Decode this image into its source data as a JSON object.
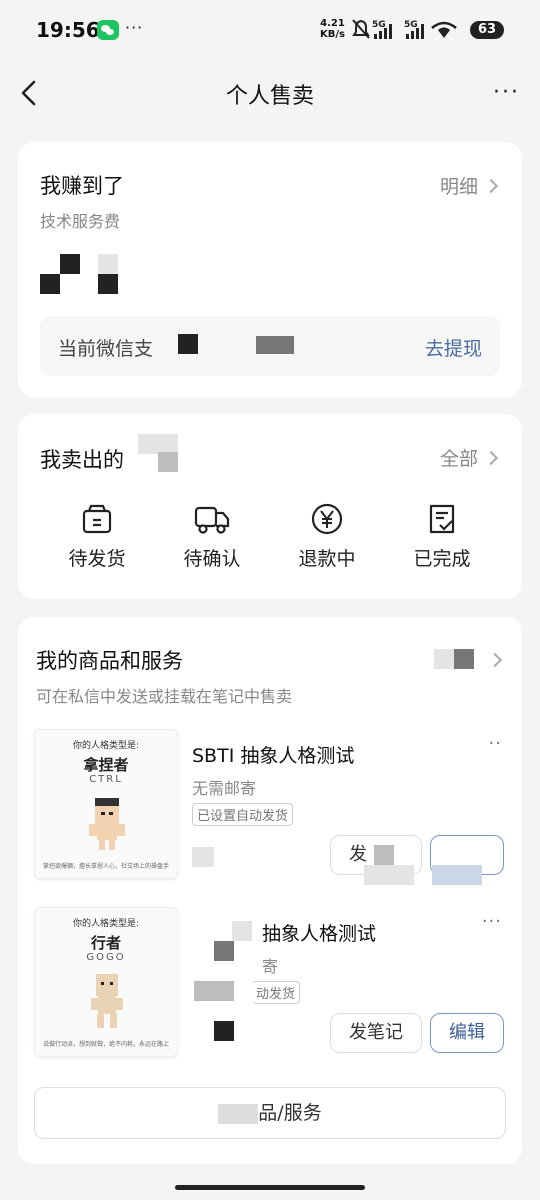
{
  "status_bar": {
    "time": "19:56",
    "dots": "···",
    "net_speed_value": "4.21",
    "net_speed_unit": "KB/s",
    "battery": "63",
    "signal_labels": [
      "5G",
      "5G"
    ]
  },
  "nav": {
    "title": "个人售卖",
    "more": "···"
  },
  "earnings": {
    "title": "我赚到了",
    "subtitle": "技术服务费",
    "details_link": "明细",
    "wechat_label": "当前微信支",
    "withdraw": "去提现"
  },
  "sold": {
    "title": "我卖出的",
    "all_link": "全部",
    "statuses": [
      {
        "label": "待发货",
        "icon": "box-icon"
      },
      {
        "label": "待确认",
        "icon": "truck-icon"
      },
      {
        "label": "退款中",
        "icon": "yuan-icon"
      },
      {
        "label": "已完成",
        "icon": "check-doc-icon"
      }
    ]
  },
  "products_section": {
    "title": "我的商品和服务",
    "subtitle": "可在私信中发送或挂载在笔记中售卖",
    "add_button": "品/服务"
  },
  "products": [
    {
      "title": "SBTI 抽象人格测试",
      "shipping": "无需邮寄",
      "tag": "已设置自动发货",
      "more": "··",
      "note_button": "发",
      "thumb": {
        "caption": "你的人格类型是:",
        "name": "拿捏者",
        "code": "CTRL",
        "desc": "掌控欲爆棚，擅长拿捏人心，社交场上的操盘手"
      }
    },
    {
      "title": "抽象人格测试",
      "shipping": "寄",
      "tag": "动发货",
      "more": "···",
      "note_button": "发笔记",
      "edit_button": "编辑",
      "thumb": {
        "caption": "你的人格类型是:",
        "name": "行者",
        "code": "GOGO",
        "desc": "说做行动派，想到就做，绝不内耗，永远在路上"
      }
    }
  ],
  "colors": {
    "accent": "#4a6b9f",
    "background": "#f4f4f4",
    "wechat": "#1ec45f"
  }
}
